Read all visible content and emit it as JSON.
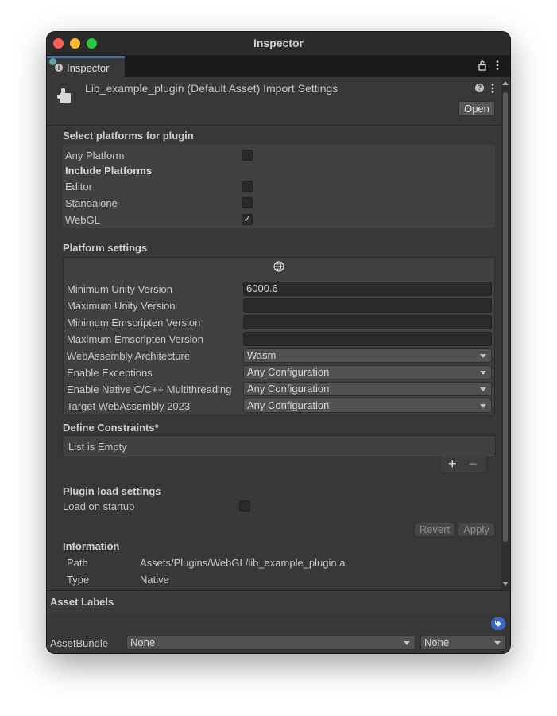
{
  "window": {
    "title": "Inspector"
  },
  "tab": {
    "label": "Inspector"
  },
  "header": {
    "title": "Lib_example_plugin (Default Asset) Import Settings",
    "open_label": "Open"
  },
  "platforms": {
    "section_title": "Select platforms for plugin",
    "any_platform_label": "Any Platform",
    "any_platform_checked": false,
    "include_label": "Include Platforms",
    "items": [
      {
        "label": "Editor",
        "checked": false
      },
      {
        "label": "Standalone",
        "checked": false
      },
      {
        "label": "WebGL",
        "checked": true
      }
    ]
  },
  "platform_settings": {
    "section_title": "Platform settings",
    "tab_icon": "globe-icon",
    "fields": [
      {
        "label": "Minimum Unity Version",
        "value": "6000.6"
      },
      {
        "label": "Maximum Unity Version",
        "value": ""
      },
      {
        "label": "Minimum Emscripten Version",
        "value": ""
      },
      {
        "label": "Maximum Emscripten Version",
        "value": ""
      }
    ],
    "dropdowns": [
      {
        "label": "WebAssembly Architecture",
        "value": "Wasm"
      },
      {
        "label": "Enable Exceptions",
        "value": "Any Configuration"
      },
      {
        "label": "Enable Native C/C++ Multithreading",
        "value": "Any Configuration"
      },
      {
        "label": "Target WebAssembly 2023",
        "value": "Any Configuration"
      }
    ]
  },
  "constraints": {
    "section_title": "Define Constraints*",
    "empty_text": "List is Empty",
    "add_label": "+",
    "remove_label": "−"
  },
  "load_settings": {
    "section_title": "Plugin load settings",
    "load_on_startup_label": "Load on startup",
    "load_on_startup_checked": false
  },
  "actions": {
    "revert_label": "Revert",
    "apply_label": "Apply"
  },
  "information": {
    "section_title": "Information",
    "path_label": "Path",
    "path_value": "Assets/Plugins/WebGL/lib_example_plugin.a",
    "type_label": "Type",
    "type_value": "Native"
  },
  "asset_labels": {
    "title": "Asset Labels",
    "icon": "tag-icon"
  },
  "asset_bundle": {
    "label": "AssetBundle",
    "name_value": "None",
    "variant_value": "None"
  },
  "colors": {
    "panel_bg": "#383838",
    "tab_accent": "#3a72b0",
    "tag_icon": "#3d67c2"
  }
}
